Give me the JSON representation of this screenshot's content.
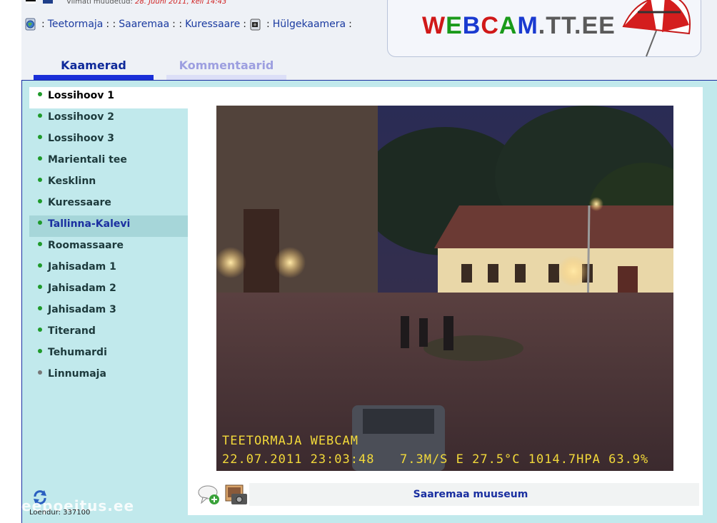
{
  "header": {
    "updated_label": "Viimati muudetud:",
    "updated_date": "28. Juuni 2011, kell 14:43",
    "breadcrumbs": [
      "Teetormaja",
      "Saaremaa",
      "Kuressaare",
      "Hülgekaamera"
    ],
    "logo": {
      "part1": "WEBCAM",
      "part2": ".TT.EE"
    }
  },
  "tabs": [
    {
      "label": "Kaamerad",
      "active": true
    },
    {
      "label": "Kommentaarid",
      "active": false
    }
  ],
  "cameras": [
    {
      "label": "Lossihoov 1",
      "state": "selected"
    },
    {
      "label": "Lossihoov 2",
      "state": "normal"
    },
    {
      "label": "Lossihoov 3",
      "state": "normal"
    },
    {
      "label": "Marientali tee",
      "state": "normal"
    },
    {
      "label": "Kesklinn",
      "state": "normal"
    },
    {
      "label": "Kuressaare",
      "state": "normal"
    },
    {
      "label": "Tallinna-Kalevi",
      "state": "hover"
    },
    {
      "label": "Roomassaare",
      "state": "normal"
    },
    {
      "label": "Jahisadam 1",
      "state": "normal"
    },
    {
      "label": "Jahisadam 2",
      "state": "normal"
    },
    {
      "label": "Jahisadam 3",
      "state": "normal"
    },
    {
      "label": "Titerand",
      "state": "normal"
    },
    {
      "label": "Tehumardi",
      "state": "normal"
    },
    {
      "label": "Linnumaja",
      "state": "offline"
    }
  ],
  "webcam": {
    "title": "TEETORMAJA WEBCAM",
    "timestamp": "22.07.2011 23:03:48",
    "readout": "7.3M/S  E  27.5°C  1014.7HPA  63.9%"
  },
  "caption": "Saaremaa muuseum",
  "footer": {
    "counter": "Loendur: 337100",
    "watermark": "eepoeitus.ee"
  },
  "colors": {
    "panel": "#c1e9ec",
    "link": "#1a3aa0",
    "online_dot": "#1e9a2a",
    "offline_dot": "#777777",
    "overlay_text": "#f2d93a"
  }
}
